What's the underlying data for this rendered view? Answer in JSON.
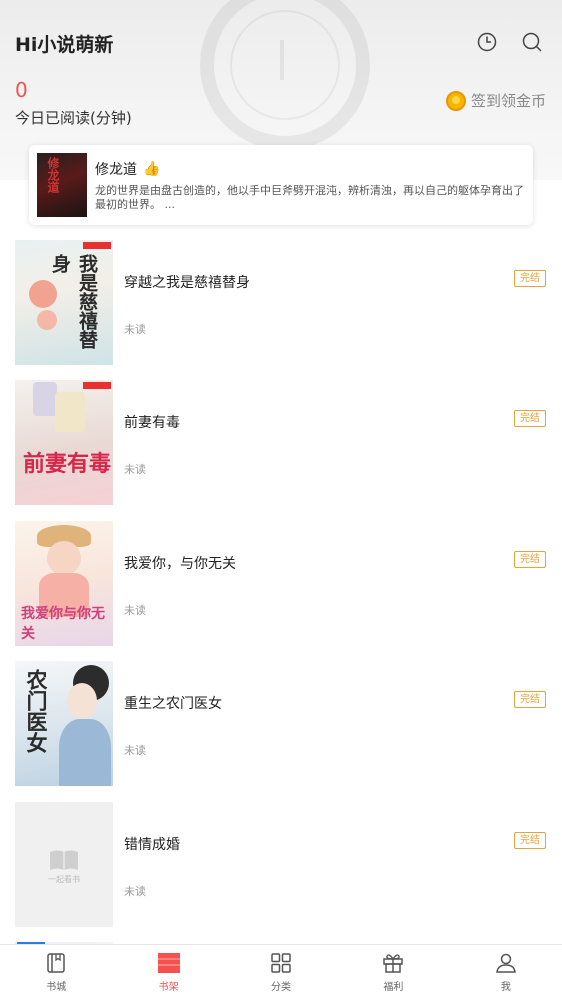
{
  "header": {
    "app_title": "Hi小说萌新",
    "history_icon": "clock-icon",
    "search_icon": "search-icon"
  },
  "reading": {
    "minutes": "0",
    "label": "今日已阅读(分钟)"
  },
  "signin": {
    "label": "签到领金币",
    "icon": "gold-coin-icon"
  },
  "recommend": {
    "title": "修龙道",
    "cover_text": "修龙道",
    "description": "龙的世界是由盘古创造的，他以手中巨斧劈开混沌，辨析清浊，再以自己的躯体孕育出了最初的世界。 ..."
  },
  "books": [
    {
      "title": "穿越之我是慈禧替身",
      "status": "未读",
      "badge": "完结",
      "cover_text": "我是慈禧替身"
    },
    {
      "title": "前妻有毒",
      "status": "未读",
      "badge": "完结",
      "cover_text": "前妻有毒"
    },
    {
      "title": "我爱你，与你无关",
      "status": "未读",
      "badge": "完结",
      "cover_text": "我爱你与你无关"
    },
    {
      "title": "重生之农门医女",
      "status": "未读",
      "badge": "完结",
      "cover_text": "农门医女"
    },
    {
      "title": "错情成婚",
      "status": "未读",
      "badge": "完结",
      "cover_text": "一起看书"
    }
  ],
  "tabs": [
    {
      "label": "书城",
      "icon": "book-icon"
    },
    {
      "label": "书架",
      "icon": "bookshelf-icon",
      "active": true
    },
    {
      "label": "分类",
      "icon": "grid-icon"
    },
    {
      "label": "福利",
      "icon": "gift-icon"
    },
    {
      "label": "我",
      "icon": "user-icon"
    }
  ],
  "colors": {
    "accent": "#f5524f",
    "badge": "#e6a23c",
    "coin": "#f7b500"
  }
}
